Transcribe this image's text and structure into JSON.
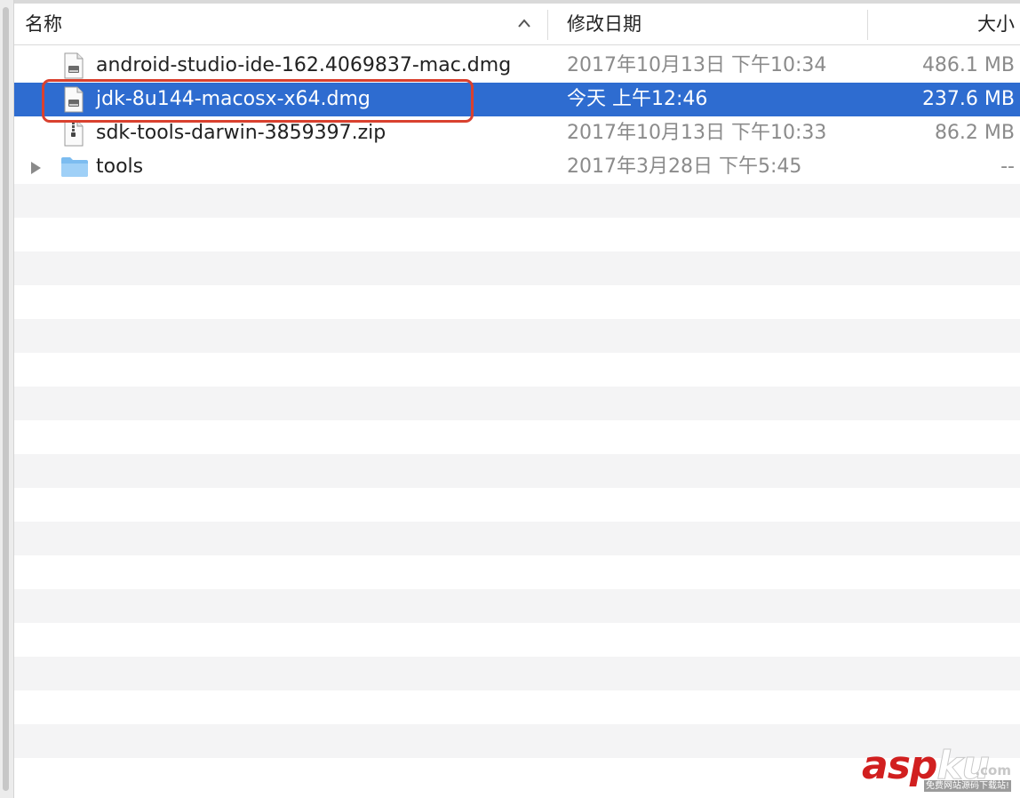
{
  "header": {
    "name_label": "名称",
    "date_label": "修改日期",
    "size_label": "大小"
  },
  "files": [
    {
      "icon": "dmg-file-icon",
      "name": "android-studio-ide-162.4069837-mac.dmg",
      "date": "2017年10月13日 下午10:34",
      "size": "486.1 MB",
      "selected": false
    },
    {
      "icon": "dmg-file-icon",
      "name": "jdk-8u144-macosx-x64.dmg",
      "date": "今天 上午12:46",
      "size": "237.6 MB",
      "selected": true
    },
    {
      "icon": "zip-file-icon",
      "name": "sdk-tools-darwin-3859397.zip",
      "date": "2017年10月13日 下午10:33",
      "size": "86.2 MB",
      "selected": false
    },
    {
      "icon": "folder-icon",
      "name": "tools",
      "date": "2017年3月28日 下午5:45",
      "size": "--",
      "selected": false
    }
  ],
  "watermark": {
    "brand_red": "asp",
    "brand_white": "ku",
    "domain": ".com",
    "tagline": "免费网站源码下载站!"
  },
  "colors": {
    "selection": "#2e6cd0",
    "highlight": "#d9412f",
    "alt_row": "#f4f4f5"
  }
}
